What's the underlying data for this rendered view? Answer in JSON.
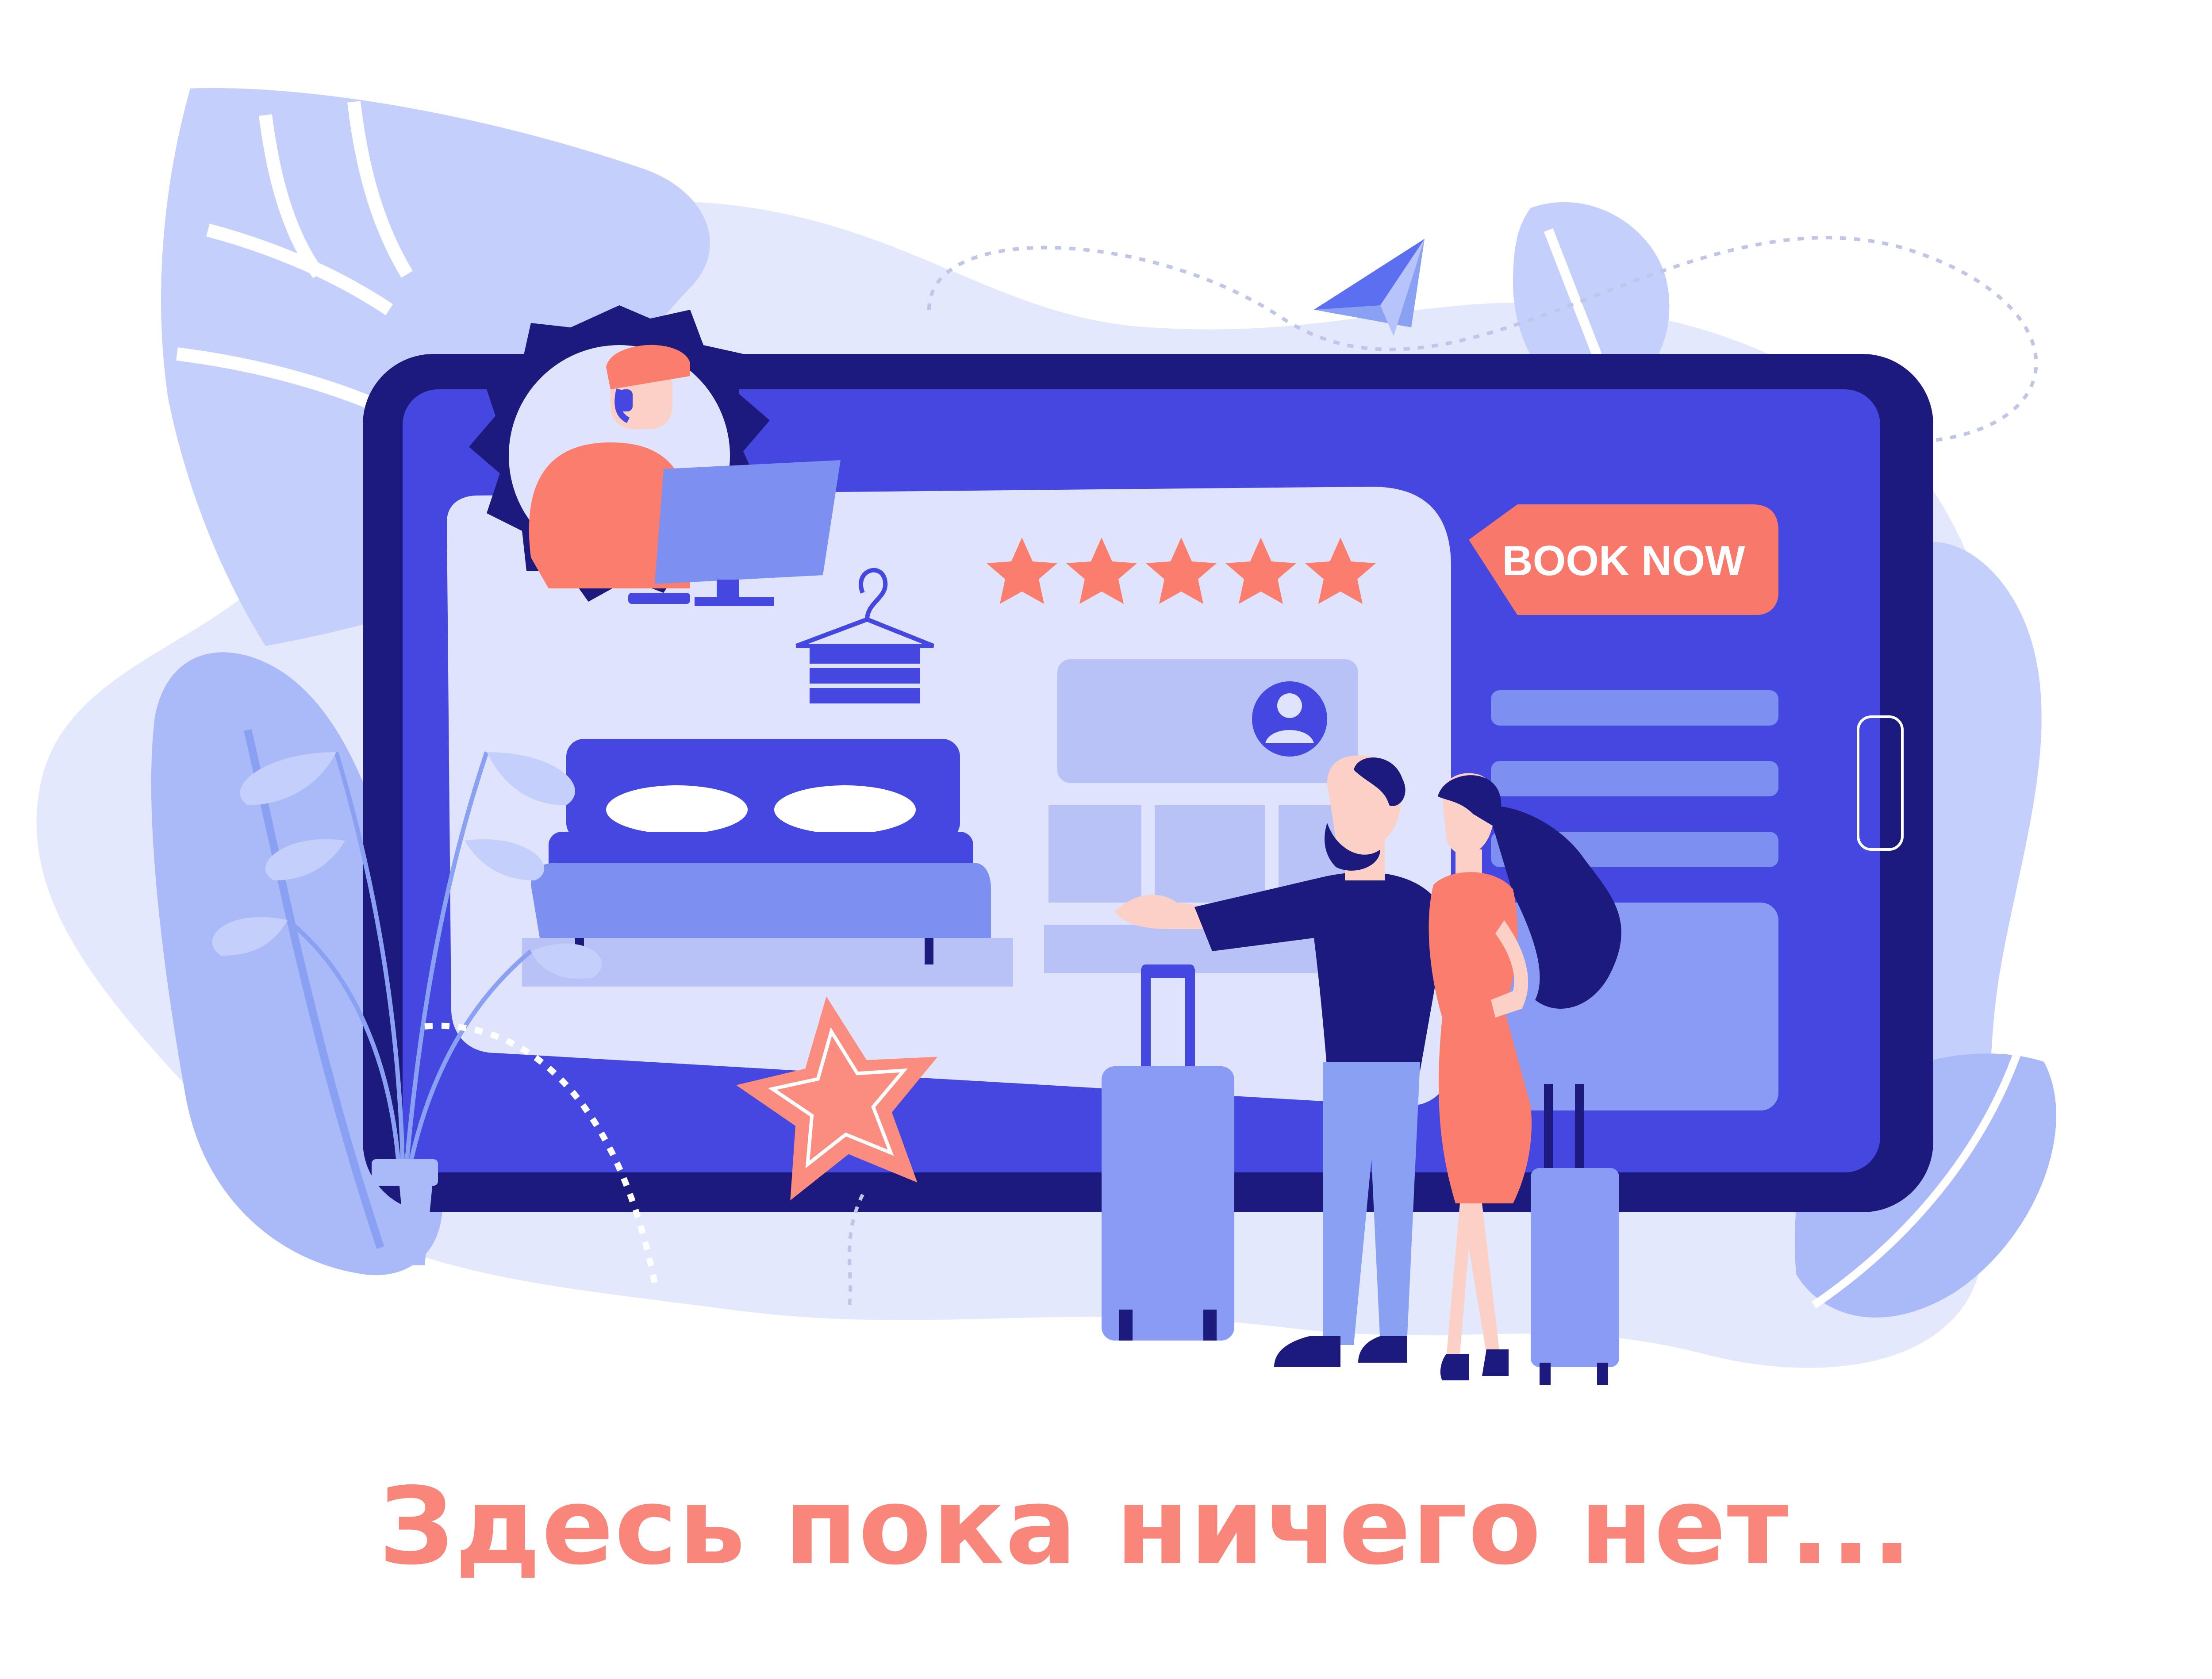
{
  "illustration": {
    "book_button_label": "BOOK NOW",
    "rating_stars": 5,
    "icons": {
      "support": "support-agent-gear-icon",
      "hanger": "hanger-icon",
      "user": "user-avatar-icon",
      "bed": "bed-icon",
      "plane": "paper-plane-icon",
      "favorite": "star-icon"
    }
  },
  "message": {
    "text": "Здесь пока ничего нет..."
  },
  "colors": {
    "tablet_frame": "#1d1a7d",
    "screen": "#4447e0",
    "panel": "#dfe3fb",
    "accent_coral": "#fa7d6d",
    "button": "#f8786b",
    "message_text": "#f8867a",
    "leaf_light": "#c4d0fb",
    "leaf_mid": "#9fb2f7",
    "blob_bg": "#e3e8fd"
  }
}
